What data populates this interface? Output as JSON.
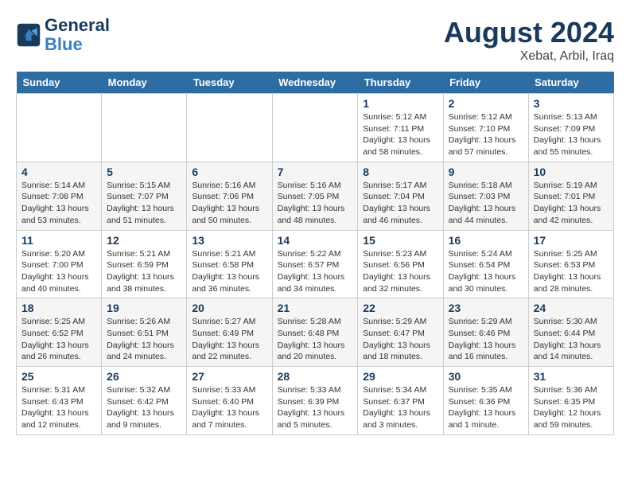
{
  "header": {
    "logo_line1": "General",
    "logo_line2": "Blue",
    "month_year": "August 2024",
    "location": "Xebat, Arbil, Iraq"
  },
  "weekdays": [
    "Sunday",
    "Monday",
    "Tuesday",
    "Wednesday",
    "Thursday",
    "Friday",
    "Saturday"
  ],
  "weeks": [
    [
      {
        "day": "",
        "info": ""
      },
      {
        "day": "",
        "info": ""
      },
      {
        "day": "",
        "info": ""
      },
      {
        "day": "",
        "info": ""
      },
      {
        "day": "1",
        "info": "Sunrise: 5:12 AM\nSunset: 7:11 PM\nDaylight: 13 hours\nand 58 minutes."
      },
      {
        "day": "2",
        "info": "Sunrise: 5:12 AM\nSunset: 7:10 PM\nDaylight: 13 hours\nand 57 minutes."
      },
      {
        "day": "3",
        "info": "Sunrise: 5:13 AM\nSunset: 7:09 PM\nDaylight: 13 hours\nand 55 minutes."
      }
    ],
    [
      {
        "day": "4",
        "info": "Sunrise: 5:14 AM\nSunset: 7:08 PM\nDaylight: 13 hours\nand 53 minutes."
      },
      {
        "day": "5",
        "info": "Sunrise: 5:15 AM\nSunset: 7:07 PM\nDaylight: 13 hours\nand 51 minutes."
      },
      {
        "day": "6",
        "info": "Sunrise: 5:16 AM\nSunset: 7:06 PM\nDaylight: 13 hours\nand 50 minutes."
      },
      {
        "day": "7",
        "info": "Sunrise: 5:16 AM\nSunset: 7:05 PM\nDaylight: 13 hours\nand 48 minutes."
      },
      {
        "day": "8",
        "info": "Sunrise: 5:17 AM\nSunset: 7:04 PM\nDaylight: 13 hours\nand 46 minutes."
      },
      {
        "day": "9",
        "info": "Sunrise: 5:18 AM\nSunset: 7:03 PM\nDaylight: 13 hours\nand 44 minutes."
      },
      {
        "day": "10",
        "info": "Sunrise: 5:19 AM\nSunset: 7:01 PM\nDaylight: 13 hours\nand 42 minutes."
      }
    ],
    [
      {
        "day": "11",
        "info": "Sunrise: 5:20 AM\nSunset: 7:00 PM\nDaylight: 13 hours\nand 40 minutes."
      },
      {
        "day": "12",
        "info": "Sunrise: 5:21 AM\nSunset: 6:59 PM\nDaylight: 13 hours\nand 38 minutes."
      },
      {
        "day": "13",
        "info": "Sunrise: 5:21 AM\nSunset: 6:58 PM\nDaylight: 13 hours\nand 36 minutes."
      },
      {
        "day": "14",
        "info": "Sunrise: 5:22 AM\nSunset: 6:57 PM\nDaylight: 13 hours\nand 34 minutes."
      },
      {
        "day": "15",
        "info": "Sunrise: 5:23 AM\nSunset: 6:56 PM\nDaylight: 13 hours\nand 32 minutes."
      },
      {
        "day": "16",
        "info": "Sunrise: 5:24 AM\nSunset: 6:54 PM\nDaylight: 13 hours\nand 30 minutes."
      },
      {
        "day": "17",
        "info": "Sunrise: 5:25 AM\nSunset: 6:53 PM\nDaylight: 13 hours\nand 28 minutes."
      }
    ],
    [
      {
        "day": "18",
        "info": "Sunrise: 5:25 AM\nSunset: 6:52 PM\nDaylight: 13 hours\nand 26 minutes."
      },
      {
        "day": "19",
        "info": "Sunrise: 5:26 AM\nSunset: 6:51 PM\nDaylight: 13 hours\nand 24 minutes."
      },
      {
        "day": "20",
        "info": "Sunrise: 5:27 AM\nSunset: 6:49 PM\nDaylight: 13 hours\nand 22 minutes."
      },
      {
        "day": "21",
        "info": "Sunrise: 5:28 AM\nSunset: 6:48 PM\nDaylight: 13 hours\nand 20 minutes."
      },
      {
        "day": "22",
        "info": "Sunrise: 5:29 AM\nSunset: 6:47 PM\nDaylight: 13 hours\nand 18 minutes."
      },
      {
        "day": "23",
        "info": "Sunrise: 5:29 AM\nSunset: 6:46 PM\nDaylight: 13 hours\nand 16 minutes."
      },
      {
        "day": "24",
        "info": "Sunrise: 5:30 AM\nSunset: 6:44 PM\nDaylight: 13 hours\nand 14 minutes."
      }
    ],
    [
      {
        "day": "25",
        "info": "Sunrise: 5:31 AM\nSunset: 6:43 PM\nDaylight: 13 hours\nand 12 minutes."
      },
      {
        "day": "26",
        "info": "Sunrise: 5:32 AM\nSunset: 6:42 PM\nDaylight: 13 hours\nand 9 minutes."
      },
      {
        "day": "27",
        "info": "Sunrise: 5:33 AM\nSunset: 6:40 PM\nDaylight: 13 hours\nand 7 minutes."
      },
      {
        "day": "28",
        "info": "Sunrise: 5:33 AM\nSunset: 6:39 PM\nDaylight: 13 hours\nand 5 minutes."
      },
      {
        "day": "29",
        "info": "Sunrise: 5:34 AM\nSunset: 6:37 PM\nDaylight: 13 hours\nand 3 minutes."
      },
      {
        "day": "30",
        "info": "Sunrise: 5:35 AM\nSunset: 6:36 PM\nDaylight: 13 hours\nand 1 minute."
      },
      {
        "day": "31",
        "info": "Sunrise: 5:36 AM\nSunset: 6:35 PM\nDaylight: 12 hours\nand 59 minutes."
      }
    ]
  ]
}
